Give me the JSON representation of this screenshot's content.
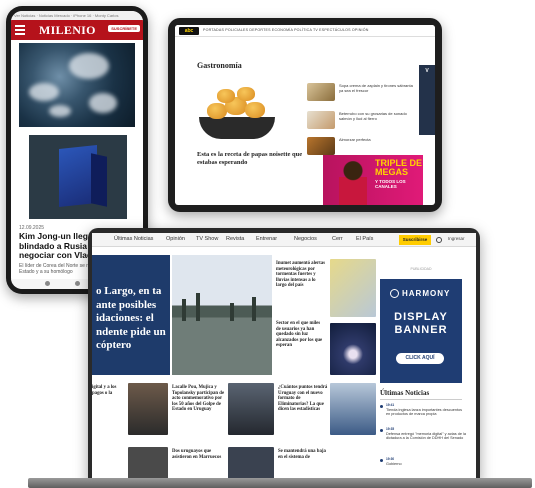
{
  "phone": {
    "tabs_text": "Ver Noticias · Noticias Mercado · iPhone 16 · Monty Carlos",
    "logo": "MILENIO",
    "subscribe": "SUSCRÍBETE",
    "date": "12.09.2025",
    "headline": "Kim Jong-un llega en tren blindado a Rusia para negociar con Vladimir Putin",
    "body": "El líder de Corea del Norte se reunirá con el Jefe de Estado y a su homólogo"
  },
  "tablet": {
    "logo": "abc",
    "menu": "PORTADAS  POLICIALES  DEPORTES  ECONOMÍA  POLÍTICA  TV  ESPECTÁCULOS  OPINIÓN",
    "section": "Gastronomía",
    "headline": "Esta es la receta de papas noisette que estabas esperando",
    "items": [
      "Sopa crema de zaplain y tirones sábranta ya sea el frescor",
      "Beterrubo con su grosarias de sonado salmón y llud al fierro",
      "Almorzar perfecta"
    ],
    "promo_big": "TRIPLE DE MEGAS",
    "promo_small": "Y TODOS LOS CANALES",
    "side_ad": "V"
  },
  "laptop": {
    "nav": [
      "Últimas Noticias",
      "Opinión",
      "TV Show",
      "Revista",
      "Entrenar",
      "Negocios",
      "Cerr",
      "El País"
    ],
    "subscribe": "Suscribirse",
    "user": "Ingresar",
    "hero": "o Largo, en ta ante posibles idaciones: el ndente pide un cóptero",
    "stories": {
      "s1": "Inumet aumentó alertas meteorológicas por tormentas fuertes y lluvias intensas a lo largo del país",
      "s2": "Sector en el que miles de usuarios ya han quedado sin luz alcanzados por los que esperan",
      "s3": "igital y a los pagos o la",
      "s4": "Lacalle Pou, Mujica y Topolansky participan de acto conmemorativo por los 50 años del Golpe de Estado en Uruguay",
      "s5": "¿Cuántos puntos tendrá Uruguay con el nuevo formato de Eliminatorias? La que dicen las estadísticas",
      "s6": "Dos uruguayos que asistieron en Marruecos",
      "s7": "Se mantendrá una baja en el sistema de"
    },
    "ad_label": "PUBLICIDAD",
    "ad_brand": "HARMONY",
    "ad_title": "DISPLAY BANNER",
    "ad_button": "CLICK AQUÍ",
    "latest_title": "Últimas Noticias",
    "latest": [
      {
        "time": "19:41",
        "text": "Tienda inglesa lanza importantes descuentos en productos de marca propia"
      },
      {
        "time": "19:35",
        "text": "Defensa entregó \"memoria digital\" y actas de la dictadura a la Comisión de DDHH del Senado"
      },
      {
        "time": "19:30",
        "text": "Gobierno"
      }
    ]
  }
}
